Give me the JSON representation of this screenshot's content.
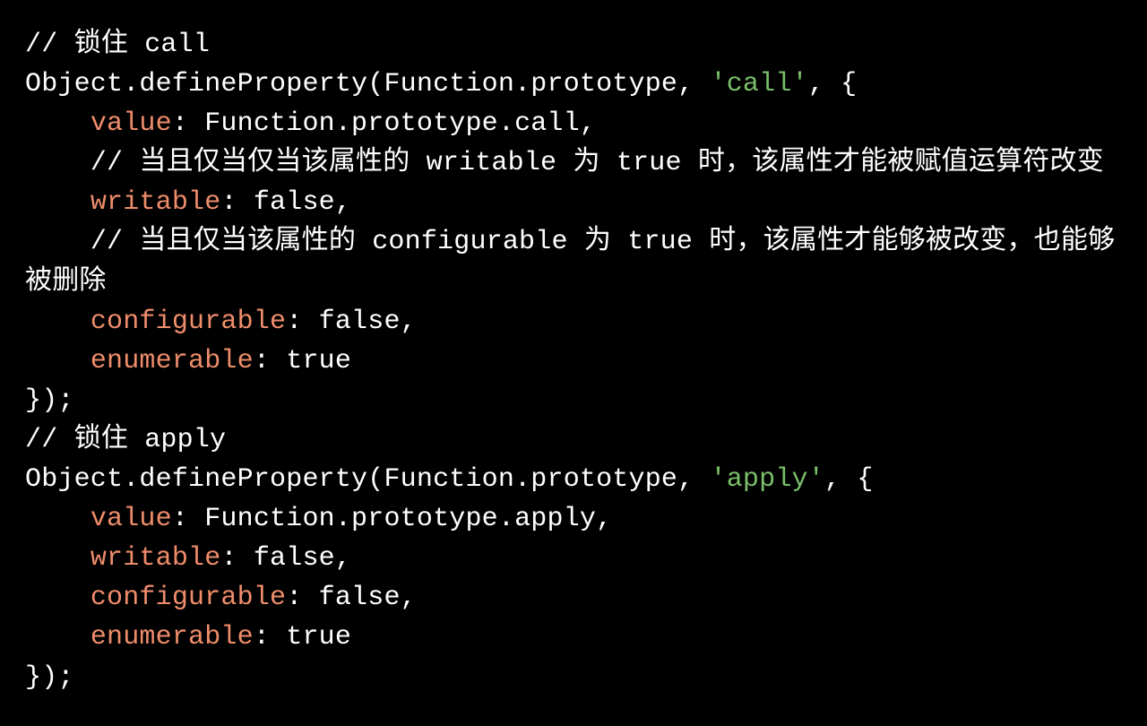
{
  "code": {
    "lines": [
      {
        "indent": 0,
        "tokens": [
          {
            "cls": "c-comment",
            "text": "// 锁住 call"
          }
        ]
      },
      {
        "indent": 0,
        "tokens": [
          {
            "cls": "c-plain",
            "text": "Object.defineProperty(Function.prototype, "
          },
          {
            "cls": "c-str",
            "text": "'call'"
          },
          {
            "cls": "c-plain",
            "text": ", {"
          }
        ]
      },
      {
        "indent": 1,
        "tokens": [
          {
            "cls": "c-key",
            "text": "value"
          },
          {
            "cls": "c-plain",
            "text": ": Function.prototype.call,"
          }
        ]
      },
      {
        "indent": 1,
        "tokens": [
          {
            "cls": "c-comment",
            "text": "// 当且仅当仅当该属性的 writable 为 true 时，该属性才能被赋值运算符改变"
          }
        ]
      },
      {
        "indent": 1,
        "tokens": [
          {
            "cls": "c-key",
            "text": "writable"
          },
          {
            "cls": "c-plain",
            "text": ": false,"
          }
        ]
      },
      {
        "indent": 1,
        "tokens": [
          {
            "cls": "c-comment",
            "text": "// 当且仅当该属性的 configurable 为 true 时，该属性才能够被改变，也能够被删除"
          }
        ]
      },
      {
        "indent": 1,
        "tokens": [
          {
            "cls": "c-key",
            "text": "configurable"
          },
          {
            "cls": "c-plain",
            "text": ": false,"
          }
        ]
      },
      {
        "indent": 1,
        "tokens": [
          {
            "cls": "c-key",
            "text": "enumerable"
          },
          {
            "cls": "c-plain",
            "text": ": true"
          }
        ]
      },
      {
        "indent": 0,
        "tokens": [
          {
            "cls": "c-plain",
            "text": "});"
          }
        ]
      },
      {
        "indent": 0,
        "tokens": [
          {
            "cls": "c-comment",
            "text": "// 锁住 apply"
          }
        ]
      },
      {
        "indent": 0,
        "tokens": [
          {
            "cls": "c-plain",
            "text": "Object.defineProperty(Function.prototype, "
          },
          {
            "cls": "c-str",
            "text": "'apply'"
          },
          {
            "cls": "c-plain",
            "text": ", {"
          }
        ]
      },
      {
        "indent": 1,
        "tokens": [
          {
            "cls": "c-key",
            "text": "value"
          },
          {
            "cls": "c-plain",
            "text": ": Function.prototype.apply,"
          }
        ]
      },
      {
        "indent": 1,
        "tokens": [
          {
            "cls": "c-key",
            "text": "writable"
          },
          {
            "cls": "c-plain",
            "text": ": false,"
          }
        ]
      },
      {
        "indent": 1,
        "tokens": [
          {
            "cls": "c-key",
            "text": "configurable"
          },
          {
            "cls": "c-plain",
            "text": ": false,"
          }
        ]
      },
      {
        "indent": 1,
        "tokens": [
          {
            "cls": "c-key",
            "text": "enumerable"
          },
          {
            "cls": "c-plain",
            "text": ": true"
          }
        ]
      },
      {
        "indent": 0,
        "tokens": [
          {
            "cls": "c-plain",
            "text": "});"
          }
        ]
      }
    ],
    "indent_unit": "    "
  }
}
